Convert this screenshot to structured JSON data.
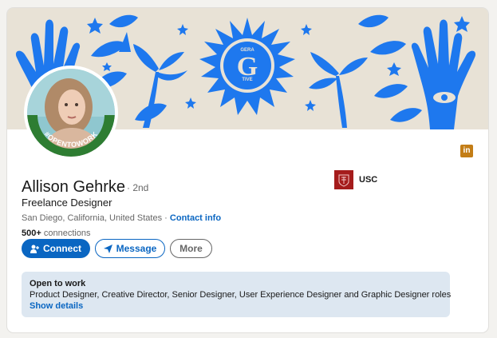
{
  "profile": {
    "name": "Allison Gehrke",
    "degree": "· 2nd",
    "headline": "Freelance Designer",
    "location": "San Diego, California, United States",
    "separator": "·",
    "contact_info": "Contact info",
    "connections_count": "500+",
    "connections_label": "connections",
    "avatar_badge": "#OPENTOWORK"
  },
  "education": {
    "label": "USC"
  },
  "actions": {
    "connect": "Connect",
    "message": "Message",
    "more": "More"
  },
  "open_to_work": {
    "title": "Open to work",
    "roles": "Product Designer, Creative Director, Senior Designer, User Experience Designer and Graphic Designer roles",
    "link": "Show details"
  },
  "banner": {
    "logo_letter": "G",
    "logo_top_text": "GERA",
    "logo_bottom_text": "TIVE"
  },
  "linkedin_badge": "in",
  "colors": {
    "accent": "#0a66c2",
    "banner_blue": "#1e78ee",
    "banner_bg": "#e8e2d6",
    "opentowork_green": "#2e7d32",
    "usc_red": "#a51c1c",
    "otw_bg": "#dde7f1"
  }
}
